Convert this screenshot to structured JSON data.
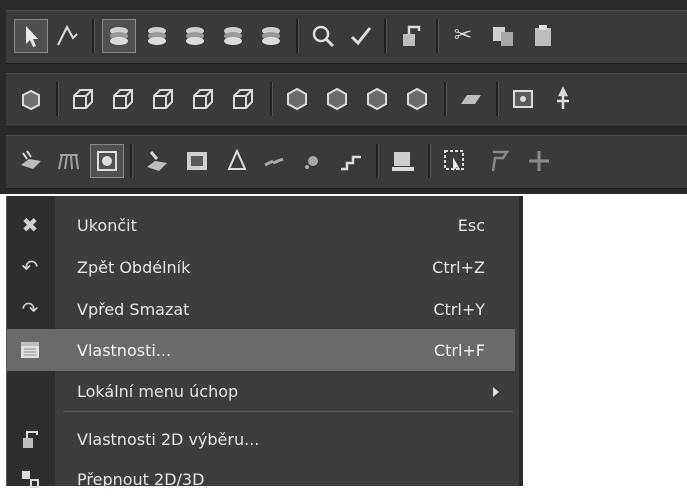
{
  "toolbars": {
    "row1": [
      "select-arrow-icon",
      "trim-icon",
      "layer-stack-1-icon",
      "layer-stack-2-icon",
      "layer-stack-3-icon",
      "layer-stack-4-icon",
      "layer-stack-5-icon",
      "zoom-icon",
      "check-edit-icon",
      "paint-bucket-icon",
      "scissors-icon",
      "copy-icon",
      "paste-icon"
    ],
    "row2": [
      "view-3d-icon",
      "box-view-1-icon",
      "box-view-2-icon",
      "box-view-3-icon",
      "box-view-4-icon",
      "box-view-5-icon",
      "sphere-1-icon",
      "sphere-2-icon",
      "sphere-3-icon",
      "sphere-4-icon",
      "plane-icon",
      "render-icon",
      "figure-icon"
    ],
    "row3": [
      "layer-hatch-icon",
      "hatch-lines-icon",
      "target-icon",
      "layer-edit-icon",
      "grid-box-icon",
      "cone-icon",
      "scatter-icon",
      "scatter-2-icon",
      "stairs-icon",
      "monitor-icon",
      "cursor-select-icon",
      "flag-icon",
      "star-icon"
    ]
  },
  "menu": {
    "items": [
      {
        "label": "Ukončit",
        "shortcut": "Esc",
        "icon": "close-icon"
      },
      {
        "label": "Zpět Obdélník",
        "shortcut": "Ctrl+Z",
        "icon": "undo-icon"
      },
      {
        "label": "Vpřed Smazat",
        "shortcut": "Ctrl+Y",
        "icon": "redo-icon"
      },
      {
        "label": "Vlastnosti...",
        "shortcut": "Ctrl+F",
        "icon": "properties-icon"
      },
      {
        "label": "Lokální menu úchop",
        "shortcut": "",
        "icon": ""
      },
      {
        "label": "Vlastnosti 2D výběru...",
        "shortcut": "",
        "icon": "properties-2d-icon"
      },
      {
        "label": "Přepnout 2D/3D",
        "shortcut": "",
        "icon": "switch-2d-3d-icon"
      }
    ]
  }
}
